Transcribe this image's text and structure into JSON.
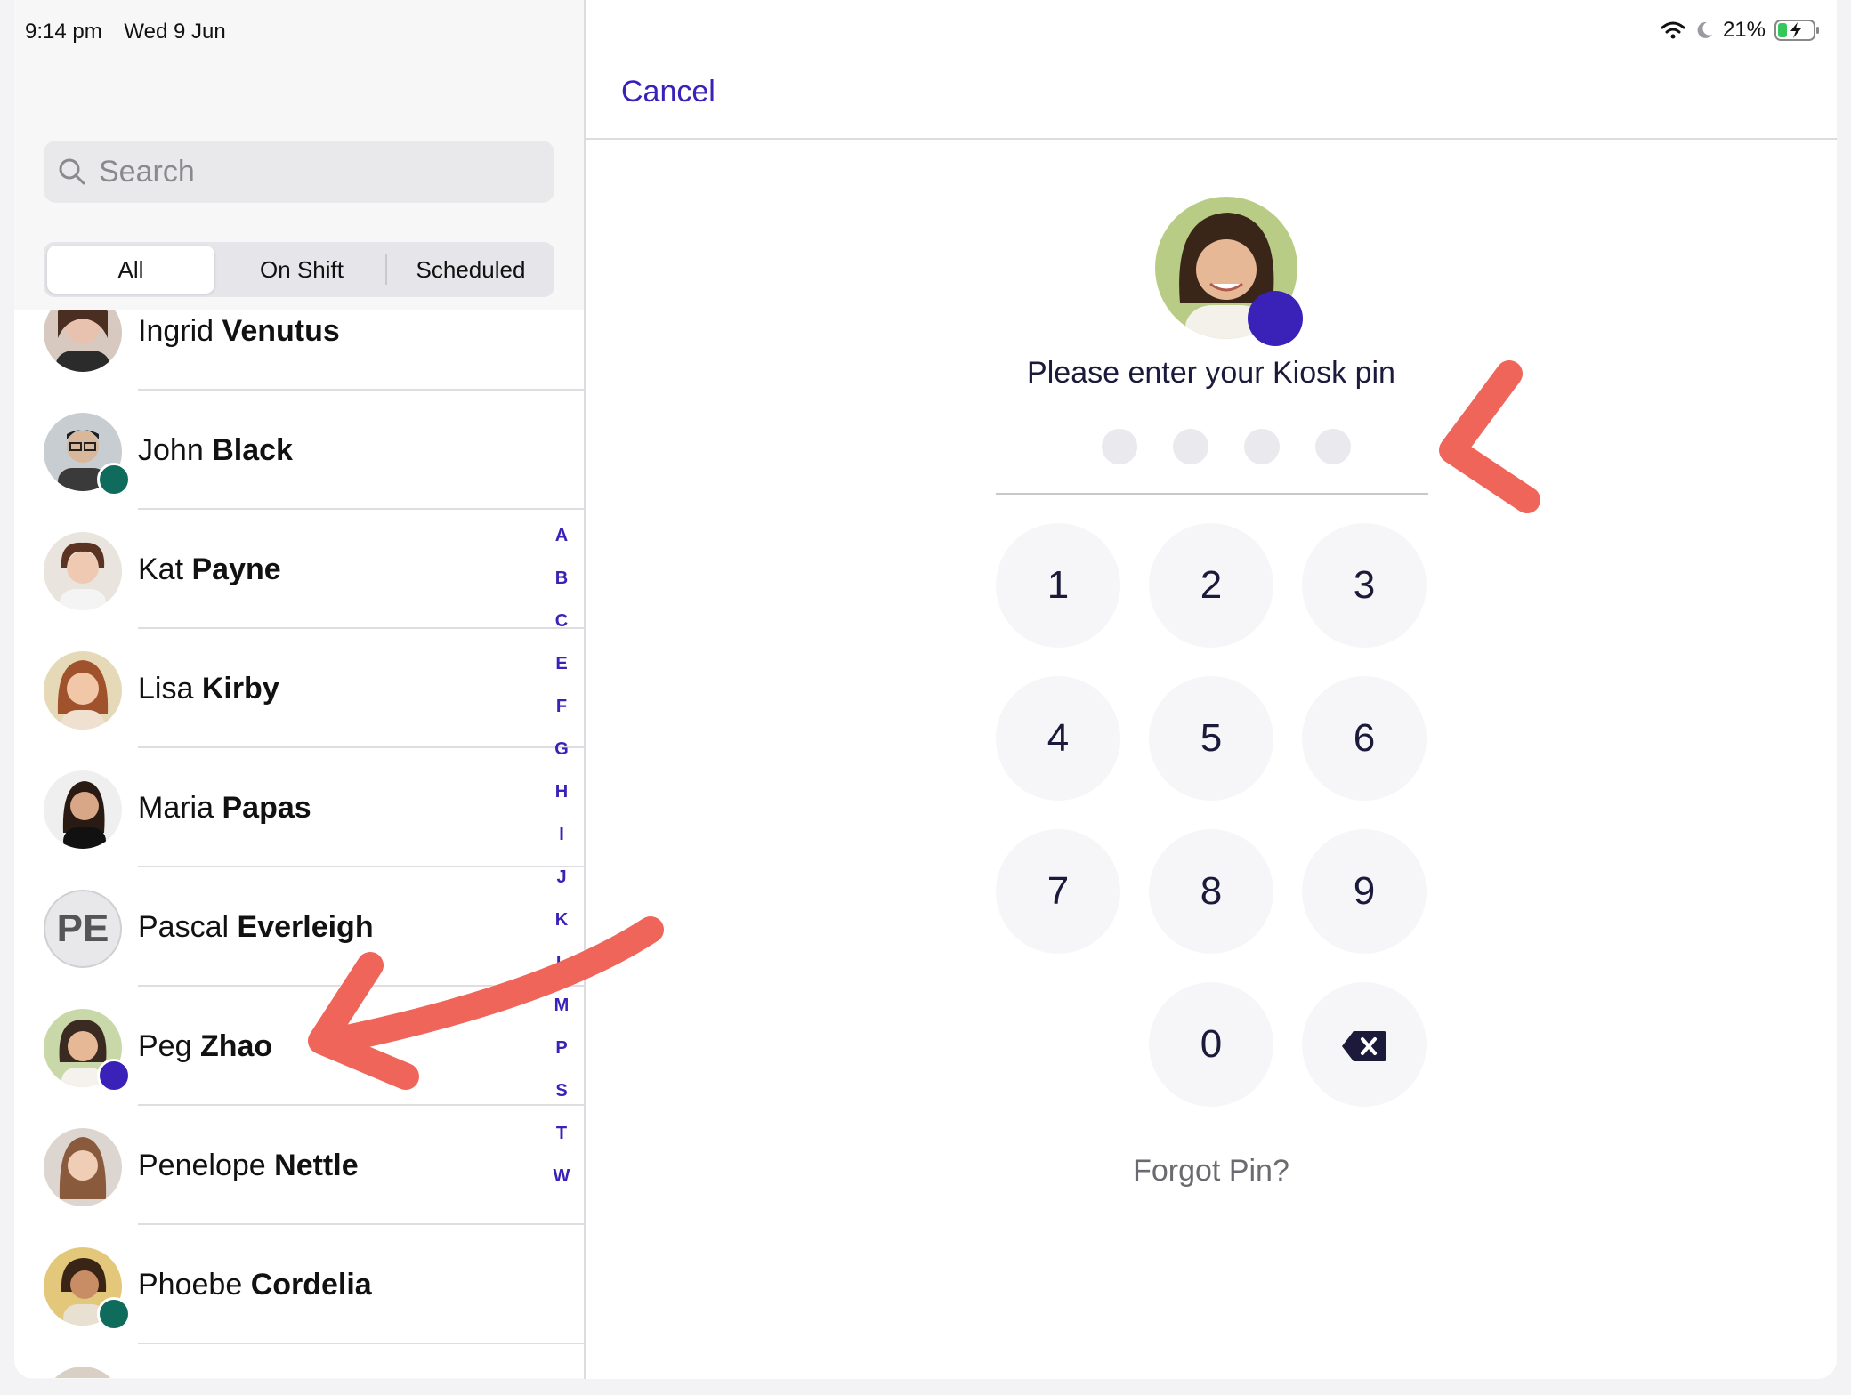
{
  "status_bar": {
    "time": "9:14 pm",
    "date": "Wed 9 Jun",
    "battery": "21%"
  },
  "search": {
    "placeholder": "Search"
  },
  "segments": [
    "All",
    "On Shift",
    "Scheduled"
  ],
  "people": [
    {
      "first": "Ingrid",
      "last": "Venutus",
      "status": null
    },
    {
      "first": "John",
      "last": "Black",
      "status": "on-shift"
    },
    {
      "first": "Kat",
      "last": "Payne",
      "status": null
    },
    {
      "first": "Lisa",
      "last": "Kirby",
      "status": null
    },
    {
      "first": "Maria",
      "last": "Papas",
      "status": null
    },
    {
      "first": "Pascal",
      "last": "Everleigh",
      "initials": "PE",
      "status": null
    },
    {
      "first": "Peg",
      "last": "Zhao",
      "status": "scheduled"
    },
    {
      "first": "Penelope",
      "last": "Nettle",
      "status": null
    },
    {
      "first": "Phoebe",
      "last": "Cordelia",
      "status": "on-shift"
    }
  ],
  "index_letters": [
    "A",
    "B",
    "C",
    "E",
    "F",
    "G",
    "H",
    "I",
    "J",
    "K",
    "L",
    "M",
    "P",
    "S",
    "T",
    "W"
  ],
  "right": {
    "cancel": "Cancel",
    "prompt": "Please enter your Kiosk pin",
    "keys": [
      "1",
      "2",
      "3",
      "4",
      "5",
      "6",
      "7",
      "8",
      "9",
      "0"
    ],
    "forgot": "Forgot Pin?"
  },
  "colors": {
    "accent": "#3a22b8",
    "on_shift": "#0f6b5c",
    "scheduled": "#3a22b8",
    "annotation_arrow": "#f0655a"
  }
}
